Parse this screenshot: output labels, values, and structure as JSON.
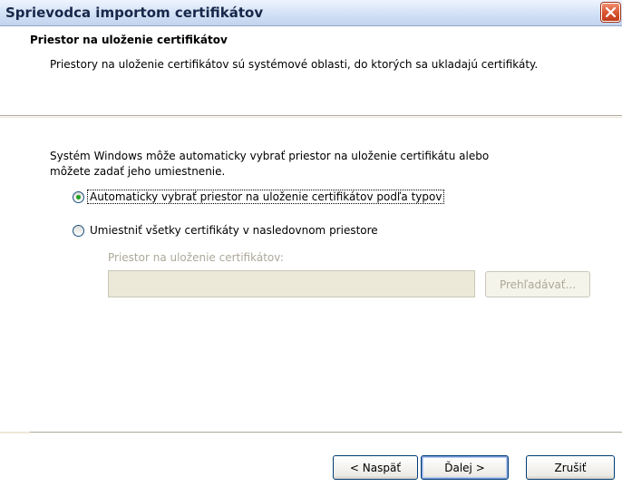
{
  "window": {
    "title": "Sprievodca importom certifikátov"
  },
  "header": {
    "title": "Priestor na uloženie certifikátov",
    "subtitle": "Priestory na uloženie certifikátov sú systémové oblasti, do ktorých sa ukladajú certifikáty."
  },
  "content": {
    "intro_line1": "Systém Windows môže automaticky vybrať priestor na uloženie certifikátu alebo",
    "intro_line2": "môžete zadať jeho umiestnenie.",
    "option_auto": {
      "label": "Automaticky vybrať priestor na uloženie certifikátov podľa typov",
      "checked": true
    },
    "option_manual": {
      "label": "Umiestniť všetky certifikáty v nasledovnom priestore",
      "checked": false
    },
    "store_label": "Priestor na uloženie certifikátov:",
    "store_value": "",
    "browse_label": "Prehľadávať..."
  },
  "buttons": {
    "back": "< Naspäť",
    "next": "Ďalej >",
    "cancel": "Zrušiť"
  },
  "colors": {
    "title_text": "#17274a",
    "close_button": "#d9532e",
    "radio_dot": "#21a121",
    "disabled_text": "#aca899"
  }
}
